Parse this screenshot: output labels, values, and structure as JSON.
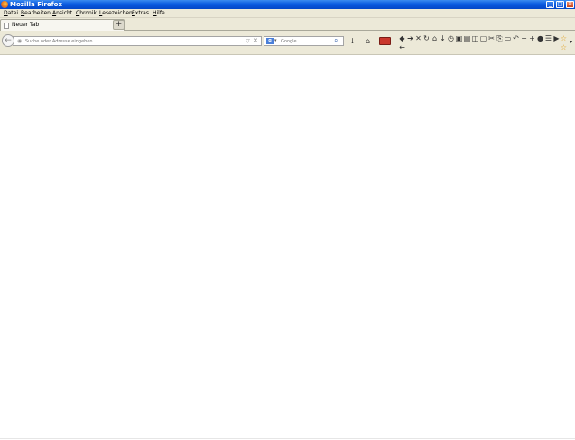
{
  "window": {
    "title": "Mozilla Firefox",
    "controls": {
      "minimize": "_",
      "maximize": "□",
      "close": "✕"
    }
  },
  "menu": {
    "items": [
      "Datei",
      "Bearbeiten",
      "Ansicht",
      "Chronik",
      "Lesezeichen",
      "Extras",
      "Hilfe"
    ]
  },
  "tabs": [
    {
      "label": "Neuer Tab",
      "active": true
    }
  ],
  "new_tab_label": "+",
  "navbar": {
    "back_glyph": "←",
    "url_placeholder": "Suche oder Adresse eingeben",
    "search_engine_label": "g",
    "search_placeholder": "Google"
  },
  "toolbar_icons": {
    "downloads": "↓",
    "home": "⌂",
    "extras": [
      "◆",
      "➔",
      "✕",
      "↻",
      "⌂",
      "↓",
      "◷",
      "▣",
      "▤",
      "◫",
      "▢",
      "✂",
      "⎘",
      "▭",
      "↶",
      "−",
      "+",
      "●",
      "☰",
      "▶",
      "☆"
    ],
    "back_small": "←",
    "overflow": "▾"
  },
  "colors": {
    "titlebar": "#0a5ae0",
    "chrome": "#ece9d8",
    "addon_red": "#c9372c"
  }
}
